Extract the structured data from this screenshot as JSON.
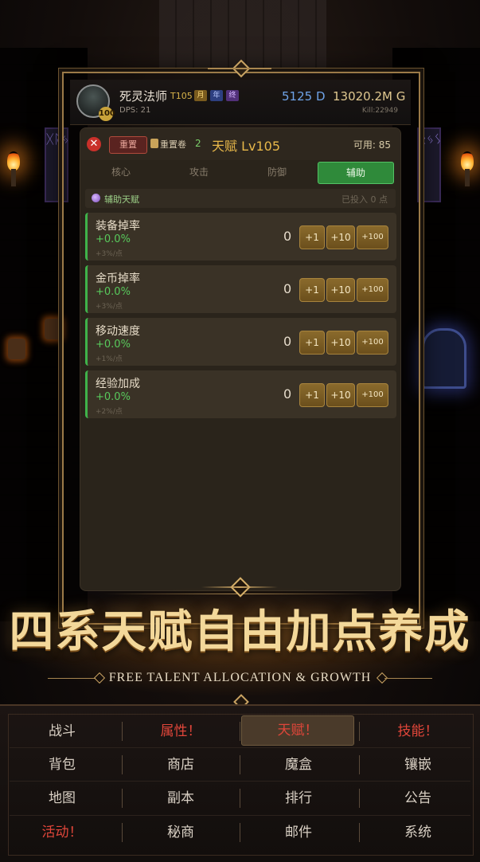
{
  "header": {
    "hero_name": "死灵法师",
    "hero_tier": "T105",
    "tags": [
      "月",
      "年",
      "终"
    ],
    "avatar_level": "100",
    "dps": "DPS: 21",
    "diamonds": "5125 D",
    "gold": "13020.2M G",
    "kills": "Kill:22949"
  },
  "background": {
    "banner_left": "ᚷᚱᛃ",
    "banner_right": "ᛟᛃᛊ"
  },
  "talent_panel": {
    "reset_label": "重置",
    "scroll_label": "重置卷",
    "scroll_count": "2",
    "title": "天赋 Lv105",
    "available": "可用: 85",
    "tabs": [
      {
        "label": "核心"
      },
      {
        "label": "攻击"
      },
      {
        "label": "防御"
      },
      {
        "label": "辅助"
      }
    ],
    "active_tab": "辅助",
    "section_title": "辅助天赋",
    "section_invested": "已投入 0 点",
    "rows": [
      {
        "name": "装备掉率",
        "value": "+0.0%",
        "step": "+3%/点",
        "level": "0"
      },
      {
        "name": "金币掉率",
        "value": "+0.0%",
        "step": "+3%/点",
        "level": "0"
      },
      {
        "name": "移动速度",
        "value": "+0.0%",
        "step": "+1%/点",
        "level": "0"
      },
      {
        "name": "经验加成",
        "value": "+0.0%",
        "step": "+2%/点",
        "level": "0"
      }
    ],
    "buttons": {
      "plus1": "+1",
      "plus10": "+10",
      "plus100": "+100"
    }
  },
  "promo": {
    "title": "四系天赋自由加点养成",
    "subtitle": "FREE TALENT ALLOCATION & GROWTH"
  },
  "menu": {
    "rows": [
      [
        "战斗",
        "属性！",
        "天赋！",
        "技能！"
      ],
      [
        "背包",
        "商店",
        "魔盒",
        "镶嵌"
      ],
      [
        "地图",
        "副本",
        "排行",
        "公告"
      ],
      [
        "活动！",
        "秘商",
        "邮件",
        "系统"
      ]
    ]
  },
  "colors": {
    "accent_gold": "#e8b84a",
    "active_tab_green": "#2f8a3a",
    "value_green": "#58c95c",
    "alert_red": "#e0463a",
    "diamond_blue": "#6fa3e8"
  }
}
